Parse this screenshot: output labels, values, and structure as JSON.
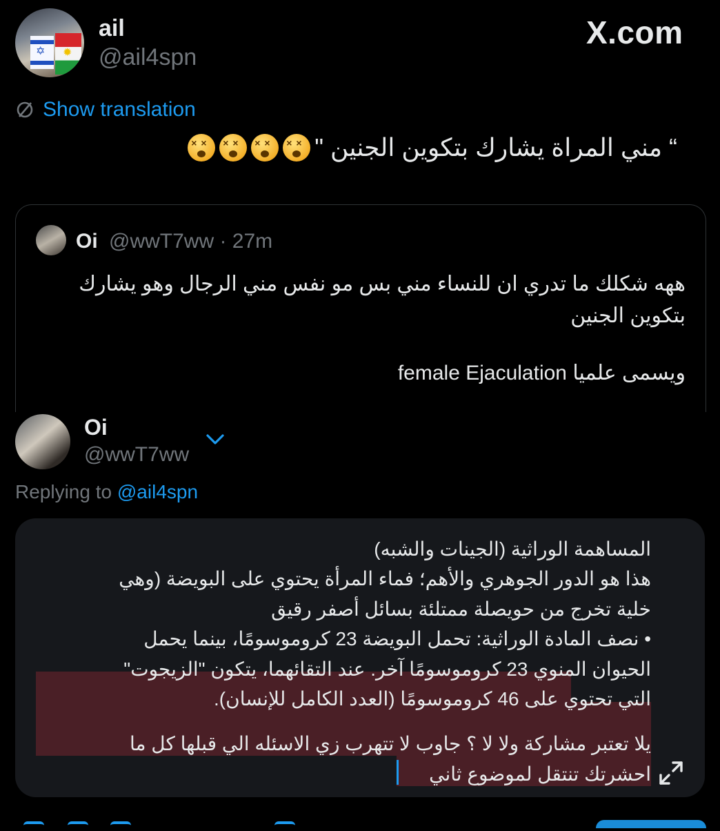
{
  "header": {
    "display_name": "ail",
    "handle": "@ail4spn",
    "site_label": "X.com"
  },
  "translation": {
    "label": "Show translation",
    "icon": "no-translate-icon"
  },
  "tweet": {
    "text": "“ مني المراة يشارك بتكوين الجنين \"",
    "emoji_icon": "face-with-crossed-out-eyes-icon",
    "emoji_count": 4
  },
  "quote": {
    "display_name": "Oi",
    "handle_time": "@wwT7ww · 27m",
    "line1": "ههه شكلك ما تدري ان للنساء مني بس مو نفس مني الرجال وهو يشارك",
    "line2": "بتكوين الجنين",
    "line3": "ويسمى علميا female Ejaculation"
  },
  "reply": {
    "display_name": "Oi",
    "handle": "@wwT7ww",
    "chevron_icon": "chevron-down-icon",
    "replying_prefix": "Replying to ",
    "replying_handle": "@ail4spn"
  },
  "composer": {
    "lines": [
      "المساهمة الوراثية (الجينات والشبه)",
      "هذا هو الدور الجوهري والأهم؛ فماء المرأة يحتوي على البويضة (وهي",
      "خلية تخرج من حويصلة ممتلئة بسائل أصفر رقيق",
      "• نصف المادة الوراثية: تحمل البويضة 23 كروموسومًا، بينما يحمل",
      "الحيوان المنوي 23 كروموسومًا آخر. عند التقائهما، يتكون \"الزيجوت\"",
      "التي تحتوي على 46 كروموسومًا (العدد الكامل للإنسان).",
      "يلا تعتبر مشاركة ولا لا ؟ جاوب لا تتهرب زي الاسئله الي قبلها كل ما",
      "احشرتك تنتقل لموضوع ثاني"
    ],
    "expand_icon": "expand-icon"
  },
  "colors": {
    "background": "#000000",
    "text": "#e7e9ea",
    "muted": "#71767b",
    "accent": "#1d9bf0",
    "composer_bg": "#16181c",
    "highlight": "#4a1f26"
  }
}
